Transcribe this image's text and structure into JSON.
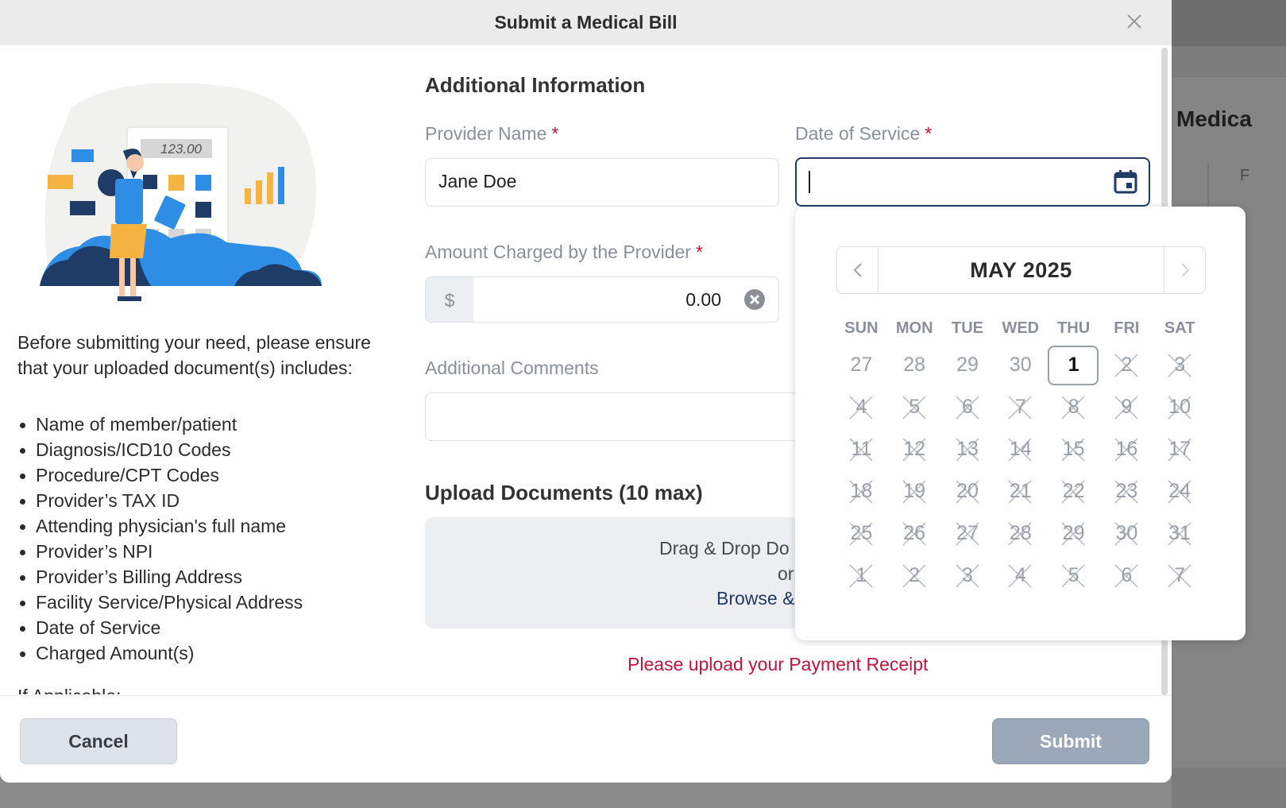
{
  "modal": {
    "title": "Submit a Medical Bill",
    "close_label": "×"
  },
  "background_page": {
    "title": "Medica",
    "letter": "F"
  },
  "illustration": {
    "calculator_display": "123.00"
  },
  "instructions": {
    "intro": "Before submitting your need, please ensure that your uploaded document(s) includes:",
    "items": [
      "Name of member/patient",
      "Diagnosis/ICD10 Codes",
      "Procedure/CPT Codes",
      "Provider’s TAX ID",
      "Attending physician's full name",
      "Provider’s NPI",
      "Provider’s Billing Address",
      "Facility Service/Physical Address",
      "Date of Service",
      "Charged Amount(s)"
    ],
    "cut_off_text": "If Applicable:"
  },
  "form": {
    "section_title": "Additional Information",
    "provider_name": {
      "label": "Provider Name",
      "required": "*",
      "value": "Jane Doe"
    },
    "date_of_service": {
      "label": "Date of Service",
      "required": "*",
      "value": ""
    },
    "amount": {
      "label": "Amount Charged by the Provider",
      "required": "*",
      "prefix": "$",
      "value": "0.00"
    },
    "comments": {
      "label": "Additional Comments",
      "value": ""
    }
  },
  "upload": {
    "title": "Upload Documents (10 max)",
    "line1": "Drag & Drop Do",
    "line2": "or",
    "line3": "Browse &",
    "error": "Please upload your Payment Receipt"
  },
  "footer": {
    "cancel_label": "Cancel",
    "submit_label": "Submit"
  },
  "calendar": {
    "month_label": "MAY 2025",
    "weekdays": [
      "SUN",
      "MON",
      "TUE",
      "WED",
      "THU",
      "FRI",
      "SAT"
    ],
    "weeks": [
      [
        [
          "27",
          "prev"
        ],
        [
          "28",
          "prev"
        ],
        [
          "29",
          "prev"
        ],
        [
          "30",
          "prev"
        ],
        [
          "1",
          "active"
        ],
        [
          "2",
          "disabled"
        ],
        [
          "3",
          "disabled"
        ]
      ],
      [
        [
          "4",
          "disabled"
        ],
        [
          "5",
          "disabled"
        ],
        [
          "6",
          "disabled"
        ],
        [
          "7",
          "disabled"
        ],
        [
          "8",
          "disabled"
        ],
        [
          "9",
          "disabled"
        ],
        [
          "10",
          "disabled"
        ]
      ],
      [
        [
          "11",
          "disabled"
        ],
        [
          "12",
          "disabled"
        ],
        [
          "13",
          "disabled"
        ],
        [
          "14",
          "disabled"
        ],
        [
          "15",
          "disabled"
        ],
        [
          "16",
          "disabled"
        ],
        [
          "17",
          "disabled"
        ]
      ],
      [
        [
          "18",
          "disabled"
        ],
        [
          "19",
          "disabled"
        ],
        [
          "20",
          "disabled"
        ],
        [
          "21",
          "disabled"
        ],
        [
          "22",
          "disabled"
        ],
        [
          "23",
          "disabled"
        ],
        [
          "24",
          "disabled"
        ]
      ],
      [
        [
          "25",
          "disabled"
        ],
        [
          "26",
          "disabled"
        ],
        [
          "27",
          "disabled"
        ],
        [
          "28",
          "disabled"
        ],
        [
          "29",
          "disabled"
        ],
        [
          "30",
          "disabled"
        ],
        [
          "31",
          "disabled"
        ]
      ],
      [
        [
          "1",
          "disabled"
        ],
        [
          "2",
          "disabled"
        ],
        [
          "3",
          "disabled"
        ],
        [
          "4",
          "disabled"
        ],
        [
          "5",
          "disabled"
        ],
        [
          "6",
          "disabled"
        ],
        [
          "7",
          "disabled"
        ]
      ]
    ]
  },
  "colors": {
    "required": "#c8102e",
    "error": "#c0143c",
    "focus_border": "#1f3c66",
    "submit_disabled": "#9aa8b9"
  }
}
